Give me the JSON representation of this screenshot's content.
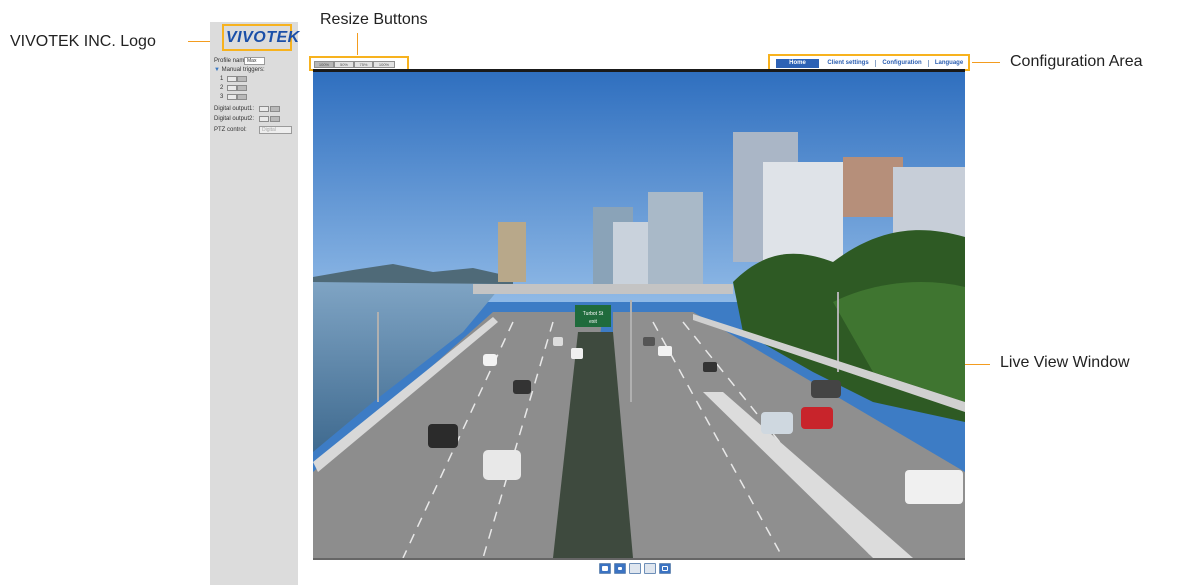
{
  "annotations": {
    "logo": "VIVOTEK INC. Logo",
    "resize": "Resize Buttons",
    "config": "Configuration Area",
    "live": "Live View Window"
  },
  "logo_text": "VIVOTEK",
  "controls": {
    "profile_label": "Profile name:",
    "profile_value": "Max",
    "manual_triggers_label": "Manual triggers:",
    "triggers": [
      "1",
      "2",
      "3"
    ],
    "digital_output1_label": "Digital output1:",
    "digital_output2_label": "Digital output2:",
    "ptz_label": "PTZ control:",
    "ptz_value": "Digital"
  },
  "resize_buttons": [
    "100%",
    "50%",
    "75%",
    "100%"
  ],
  "nav": {
    "home": "Home",
    "client_settings": "Client settings",
    "configuration": "Configuration",
    "language": "Language"
  },
  "scene": {
    "sign_line1": "Turbot St",
    "sign_line2": "exit"
  },
  "toolbar_icons": [
    "camera-icon",
    "stop-icon",
    "blank-icon",
    "blank-icon",
    "fullscreen-icon"
  ],
  "colors": {
    "highlight": "#f7b21e",
    "nav_active": "#2d62b5",
    "logo": "#1a4fa8"
  }
}
